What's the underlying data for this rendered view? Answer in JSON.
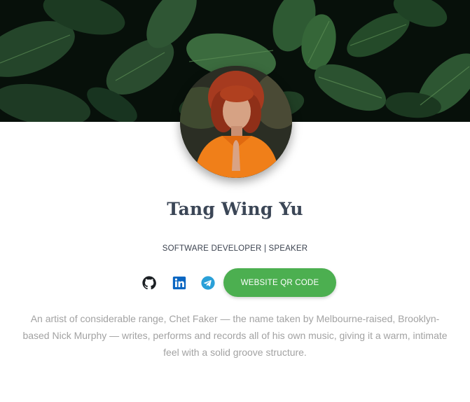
{
  "profile": {
    "name": "Tang Wing Yu",
    "role": "SOFTWARE DEVELOPER | SPEAKER",
    "bio": "An artist of considerable range, Chet Faker — the name taken by Melbourne-raised, Brooklyn-based Nick Murphy — writes, performs and records all of his own music, giving it a warm, intimate feel with a solid groove structure."
  },
  "social": {
    "icons": [
      "github-icon",
      "linkedin-icon",
      "telegram-icon"
    ],
    "qr_button_label": "WEBSITE QR CODE"
  },
  "colors": {
    "accent_button": "#4caf50",
    "name_text": "#3b4656",
    "bio_text": "#a2a2a2",
    "linkedin": "#0a66c2",
    "telegram": "#2aa0d8"
  }
}
